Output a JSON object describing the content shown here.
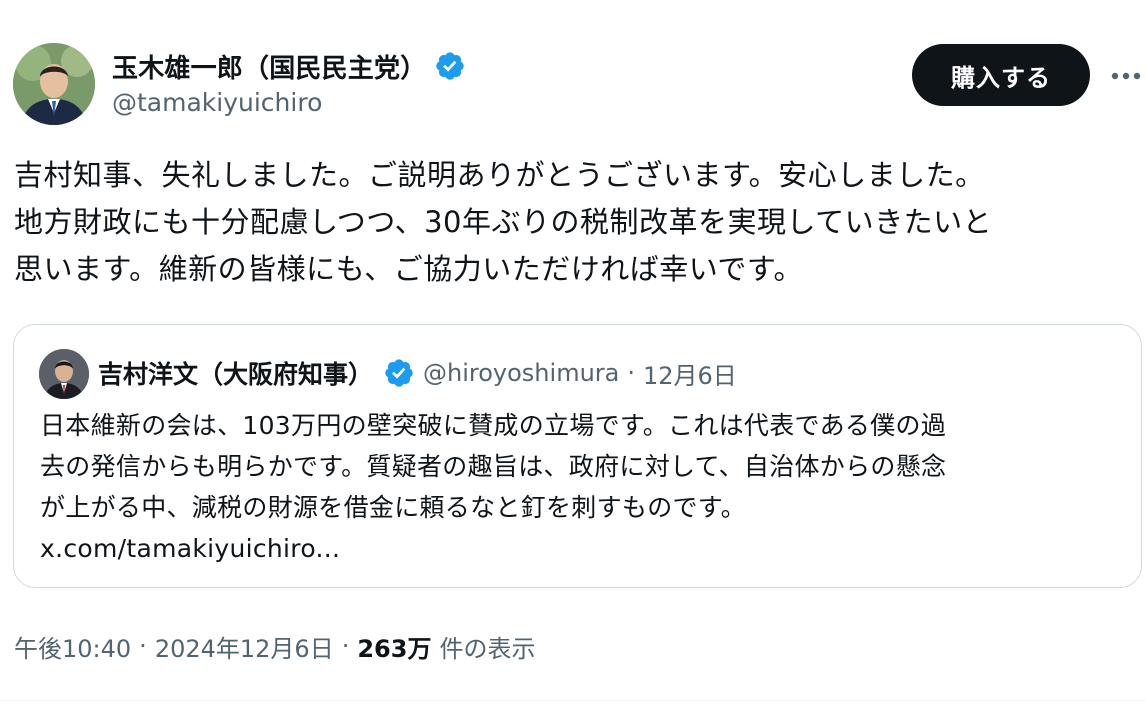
{
  "author": {
    "display_name": "玉木雄一郎（国民民主党）",
    "handle": "@tamakiyuichiro",
    "verified": true
  },
  "header": {
    "buy_label": "購入する",
    "more_icon": "more-horizontal-icon"
  },
  "tweet": {
    "lines": [
      "吉村知事、失礼しました。ご説明ありがとうございます。安心しました。",
      "地方財政にも十分配慮しつつ、30年ぶりの税制改革を実現していきたいと",
      "思います。維新の皆様にも、ご協力いただければ幸いです。"
    ]
  },
  "quote": {
    "display_name": "吉村洋文（大阪府知事）",
    "handle": "@hiroyoshimura",
    "separator": "·",
    "date": "12月6日",
    "lines": [
      "日本維新の会は、103万円の壁突破に賛成の立場です。これは代表である僕の過",
      "去の発信からも明らかです。質疑者の趣旨は、政府に対して、自治体からの懸念",
      "が上がる中、減税の財源を借金に頼るなと釘を刺すものです。",
      "x.com/tamakiyuichiro..."
    ]
  },
  "meta": {
    "time": "午後10:40",
    "separator": "·",
    "date": "2024年12月6日",
    "views_count": "263万",
    "views_label": "件の表示"
  },
  "colors": {
    "verified_blue": "#1d9bf0",
    "text_primary": "#0f1419",
    "text_secondary": "#536471",
    "border": "#cfd9de",
    "button_bg": "#0f1419"
  }
}
